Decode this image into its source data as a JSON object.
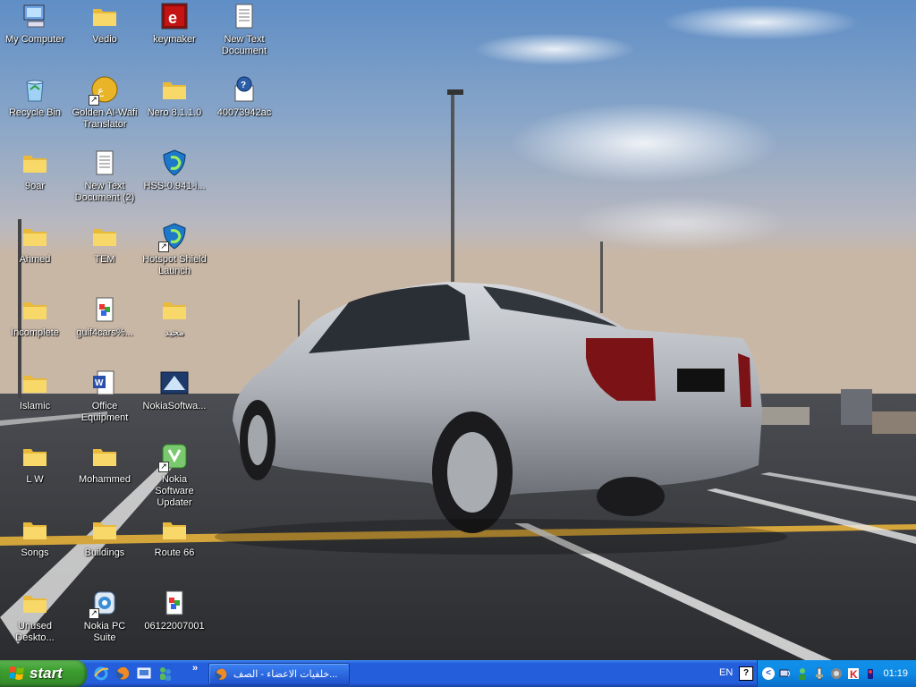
{
  "desktop": {
    "icons": [
      {
        "label": "My Computer",
        "icon": "computer-icon"
      },
      {
        "label": "Recycle Bin",
        "icon": "recycle-bin-icon"
      },
      {
        "label": "9oar",
        "icon": "folder-icon"
      },
      {
        "label": "Ahmed",
        "icon": "folder-icon"
      },
      {
        "label": "Incomplete",
        "icon": "folder-icon"
      },
      {
        "label": "Islamic",
        "icon": "folder-icon"
      },
      {
        "label": "L W",
        "icon": "folder-icon"
      },
      {
        "label": "Songs",
        "icon": "folder-icon"
      },
      {
        "label": "Unused Deskto...",
        "icon": "folder-icon"
      },
      {
        "label": "Vedio",
        "icon": "folder-icon"
      },
      {
        "label": "Golden Al-Wafi Translator",
        "icon": "translator-icon"
      },
      {
        "label": "New Text Document (2)",
        "icon": "text-document-icon"
      },
      {
        "label": "TEM",
        "icon": "folder-icon"
      },
      {
        "label": "gulf4cars%...",
        "icon": "image-file-icon"
      },
      {
        "label": "Office Equipment",
        "icon": "word-document-icon"
      },
      {
        "label": "Mohammed",
        "icon": "folder-icon"
      },
      {
        "label": "Buildings",
        "icon": "folder-icon"
      },
      {
        "label": "Nokia PC Suite",
        "icon": "nokia-pc-suite-icon"
      },
      {
        "label": "keymaker",
        "icon": "keymaker-icon"
      },
      {
        "label": "Nero 8.1.1.0",
        "icon": "folder-icon"
      },
      {
        "label": "HSS-0.941-i...",
        "icon": "hotspot-shield-icon"
      },
      {
        "label": "Hotspot Shield Launch",
        "icon": "hotspot-shield-icon"
      },
      {
        "label": "مجيد",
        "icon": "folder-icon"
      },
      {
        "label": "NokiaSoftwa...",
        "icon": "nokia-software-icon"
      },
      {
        "label": "Nokia Software Updater",
        "icon": "nokia-updater-icon"
      },
      {
        "label": "Route 66",
        "icon": "folder-icon"
      },
      {
        "label": "06122007001",
        "icon": "image-file-icon"
      },
      {
        "label": "New Text Document",
        "icon": "text-document-icon"
      },
      {
        "label": "40073942ac",
        "icon": "realplayer-file-icon"
      }
    ]
  },
  "taskbar": {
    "start_label": "start",
    "task_label": "خلفيات الاعضاء - الصف...",
    "overflow": "»",
    "language": "EN",
    "help": "?",
    "clock": "01:19"
  },
  "colors": {
    "taskbar": "#245edb",
    "start_button": "#3c9e2e",
    "tray": "#0d8ae5",
    "folder": "#f5d35a"
  }
}
